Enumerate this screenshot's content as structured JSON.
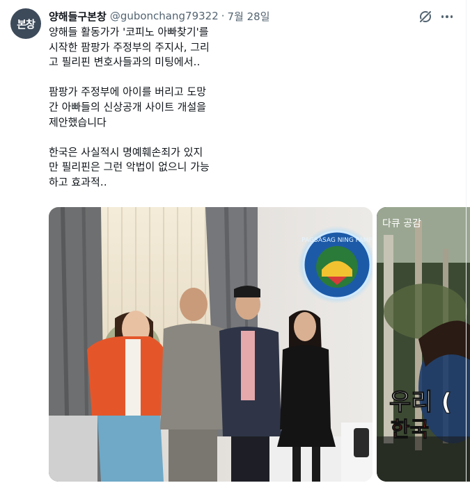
{
  "tweet": {
    "avatar_text": "본창",
    "author_name": "양해들구본창",
    "handle": "@gubonchang79322",
    "separator": "·",
    "date": "7월 28일",
    "paragraphs": [
      [
        "양해들 활동가가 '코피노 아빠찾기'를",
        "시작한 팜팡가 주정부의 주지사, 그리",
        "고 필리핀 변호사들과의 미팅에서‥"
      ],
      [
        "팜팡가 주정부에 아이를 버리고 도망",
        "간 아빠들의 신상공개 사이트 개설을",
        "제안했습니다"
      ],
      [
        "한국은 사실적시 명예훼손죄가 있지",
        "만 필리핀은 그런 악법이 없으니 가능",
        "하고 효과적‥"
      ]
    ]
  },
  "icons": {
    "grok": "grok-icon",
    "more": "more-icon"
  },
  "media": {
    "photo1": {
      "seal_text": "PAGSASAG NING PAMP"
    },
    "photo2": {
      "top_caption": "다큐 공감",
      "overlay_line1": "우리 (",
      "overlay_line2": "한국"
    }
  },
  "colors": {
    "text": "#0f1419",
    "secondary": "#536471",
    "avatar_bg": "#3d4a5a",
    "overlay_red": "#e8231f"
  }
}
